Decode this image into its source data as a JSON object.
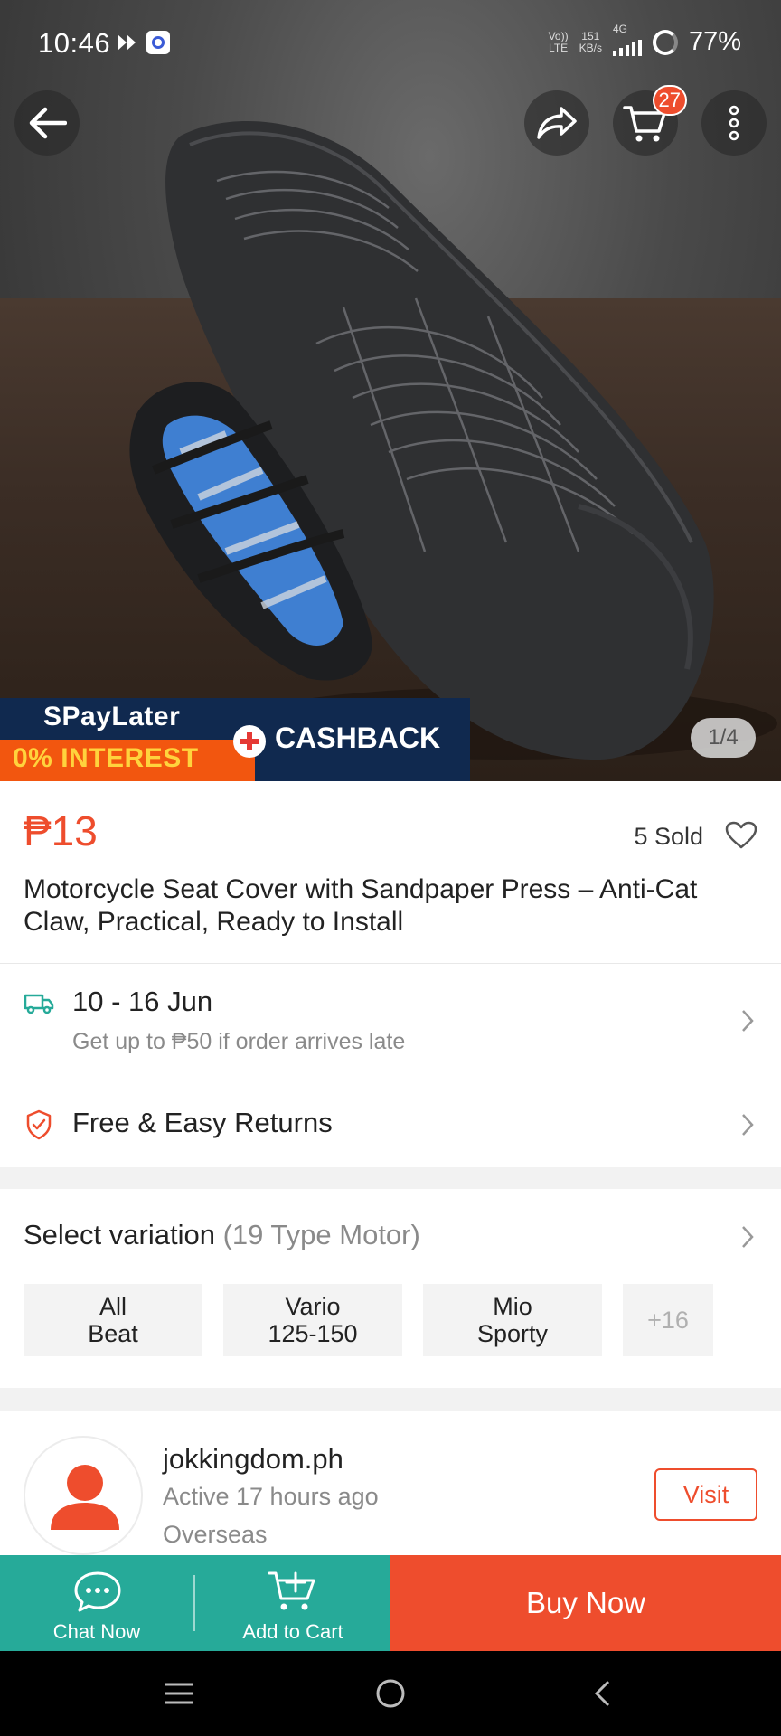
{
  "status_bar": {
    "time": "10:46",
    "net_type_top": "Vo))",
    "net_type_bottom": "LTE",
    "speed_value": "151",
    "speed_unit": "KB/s",
    "signal_label": "4G",
    "battery": "77%"
  },
  "header": {
    "cart_count": "27",
    "icons": [
      "back-arrow-icon",
      "share-icon",
      "cart-icon",
      "more-vertical-icon"
    ]
  },
  "banner": {
    "brand": "SPayLater",
    "interest": "0% INTEREST",
    "cashback": "CASHBACK"
  },
  "gallery": {
    "pager": "1/4"
  },
  "product": {
    "price": "₱13",
    "sold": "5 Sold",
    "title": "Motorcycle Seat Cover with Sandpaper Press – Anti-Cat Claw, Practical, Ready to Install"
  },
  "shipping": {
    "dates": "10 - 16 Jun",
    "guarantee": "Get up to ₱50 if order arrives late"
  },
  "returns": {
    "label": "Free & Easy Returns"
  },
  "variation": {
    "label": "Select variation",
    "count": "(19 Type Motor)",
    "options": [
      {
        "line1": "All",
        "line2": "Beat"
      },
      {
        "line1": "Vario",
        "line2": "125-150"
      },
      {
        "line1": "Mio",
        "line2": "Sporty"
      }
    ],
    "more": "+16"
  },
  "shop": {
    "name": "jokkingdom.ph",
    "active": "Active 17 hours ago",
    "location": "Overseas",
    "visit": "Visit"
  },
  "bottom_bar": {
    "chat": "Chat Now",
    "add_to_cart": "Add to Cart",
    "buy_now": "Buy Now"
  },
  "colors": {
    "brand": "#ee4d2d",
    "teal": "#26aa99",
    "muted": "#8a8a8a"
  }
}
